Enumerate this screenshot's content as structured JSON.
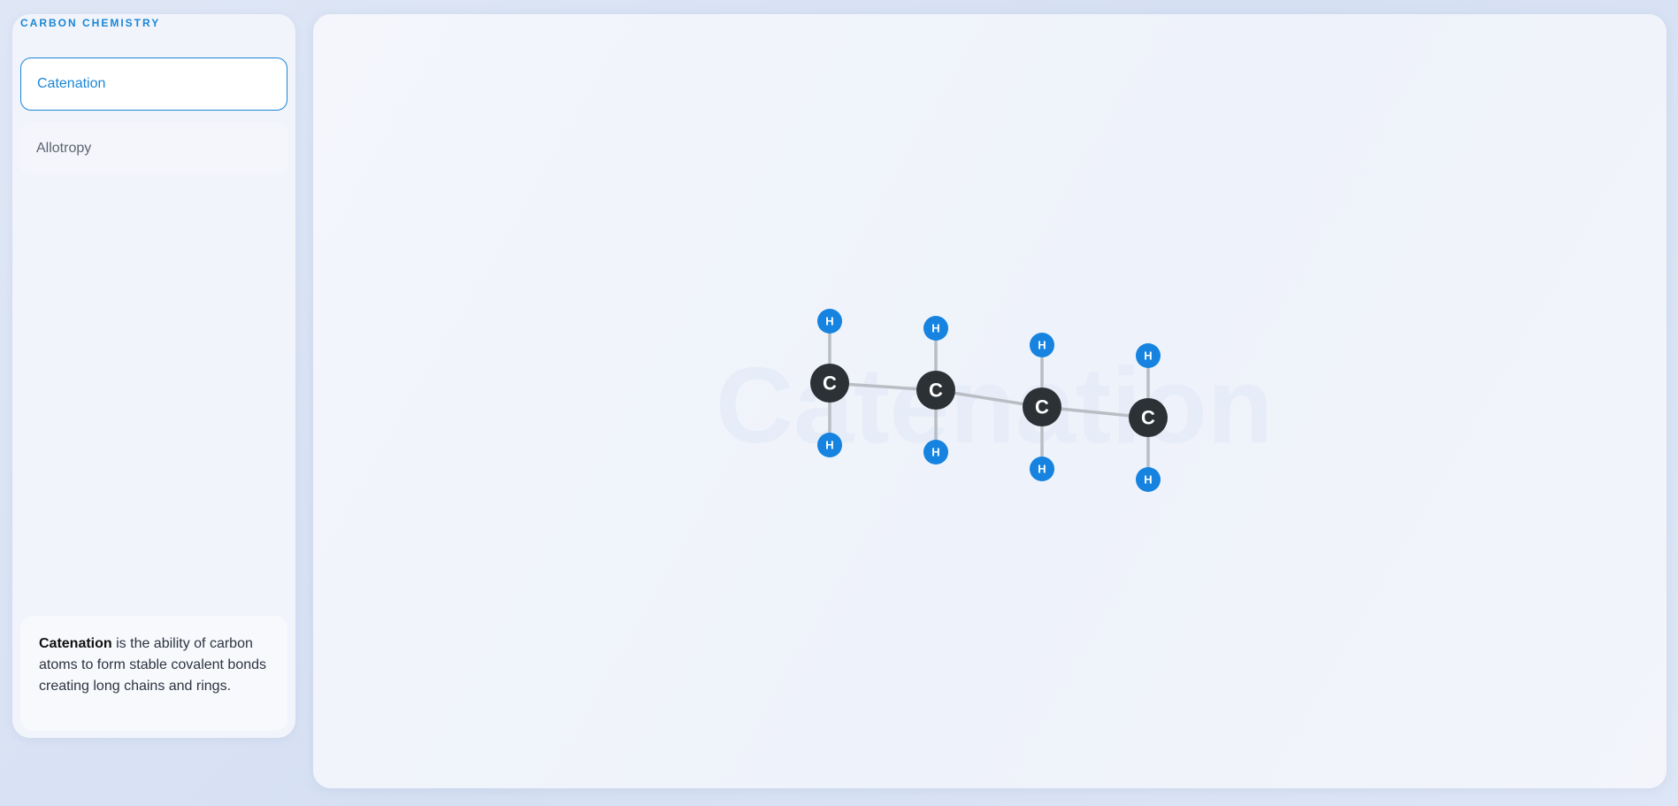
{
  "sidebar": {
    "brand": "CARBON CHEMISTRY",
    "items": [
      {
        "label": "Catenation",
        "active": true
      },
      {
        "label": "Allotropy",
        "active": false
      }
    ]
  },
  "info": {
    "term": "Catenation",
    "text": " is the ability of carbon atoms to form stable covalent bonds creating long chains and rings."
  },
  "stage": {
    "watermark": "Catenation",
    "atom_labels": {
      "carbon": "C",
      "hydrogen": "H"
    },
    "carbon_count": 4
  },
  "colors": {
    "accent": "#1a86d6",
    "carbon": "#2c3135",
    "hydrogen": "#1583df",
    "bond": "#b9bec5"
  }
}
